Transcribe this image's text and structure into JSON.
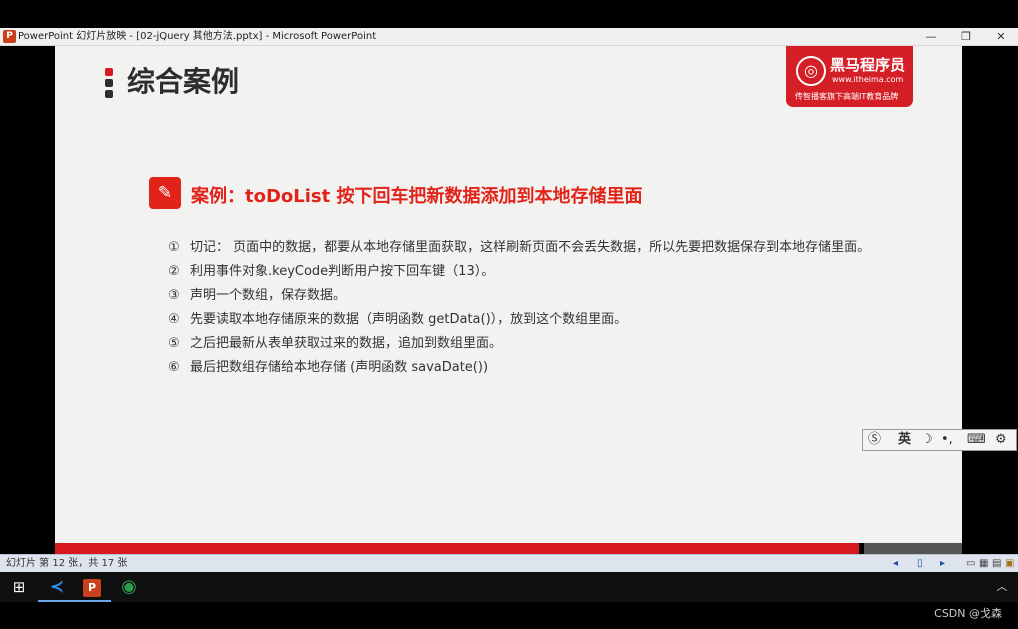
{
  "window": {
    "app_icon_letter": "P",
    "title": "PowerPoint 幻灯片放映 - [02-jQuery 其他方法.pptx] - Microsoft PowerPoint",
    "minimize": "—",
    "restore": "❐",
    "close": "✕"
  },
  "slide": {
    "title": "综合案例",
    "bullet_colors": [
      "#d71920",
      "#2d2d2d",
      "#2d2d2d"
    ],
    "logo": {
      "emblem": "◎",
      "name": "黑马程序员",
      "url": "www.itheima.com",
      "slogan": "传智播客旗下高端IT教育品牌",
      "color": "#d41f26"
    },
    "case_icon": "✎",
    "case_heading": "案例：toDoList 按下回车把新数据添加到本地存储里面",
    "steps": [
      {
        "num": "①",
        "text": "切记： 页面中的数据，都要从本地存储里面获取，这样刷新页面不会丢失数据，所以先要把数据保存到本地存储里面。"
      },
      {
        "num": "②",
        "text": "利用事件对象.keyCode判断用户按下回车键（13）。"
      },
      {
        "num": "③",
        "text": "声明一个数组，保存数据。"
      },
      {
        "num": "④",
        "text": "先要读取本地存储原来的数据（声明函数 getData()），放到这个数组里面。"
      },
      {
        "num": "⑤",
        "text": "之后把最新从表单获取过来的数据，追加到数组里面。"
      },
      {
        "num": "⑥",
        "text": "最后把数组存储给本地存储 (声明函数 savaDate())"
      }
    ]
  },
  "ime": {
    "logo": "Ⓢ",
    "lang": "英",
    "moon": "☽",
    "punct": "•,",
    "keyboard": "⌨",
    "settings": "⚙"
  },
  "statusbar": {
    "slide_info": "幻灯片 第 12 张，共 17 张",
    "prev": "◂",
    "notes": "▯",
    "next": "▸",
    "view_normal": "▭",
    "view_sorter": "▦",
    "view_reading": "▤",
    "view_show": "▣"
  },
  "taskbar": {
    "start": "⊞",
    "vscode": "≺",
    "powerpoint": "P",
    "chrome": "◉",
    "tray_chevron": "︿"
  },
  "watermark": "CSDN @戈森"
}
